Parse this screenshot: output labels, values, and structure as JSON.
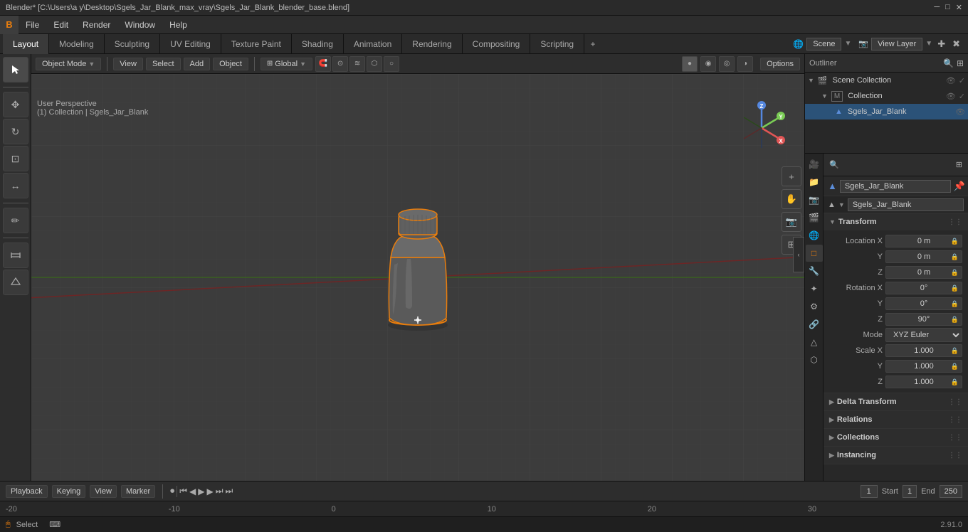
{
  "titlebar": {
    "title": "Blender* [C:\\Users\\a y\\Desktop\\Sgels_Jar_Blank_max_vray\\Sgels_Jar_Blank_blender_base.blend]",
    "minimize": "─",
    "maximize": "□",
    "close": "✕"
  },
  "menubar": {
    "logo": "B",
    "items": [
      "File",
      "Edit",
      "Render",
      "Window",
      "Help"
    ]
  },
  "workspace_tabs": {
    "tabs": [
      "Layout",
      "Modeling",
      "Sculpting",
      "UV Editing",
      "Texture Paint",
      "Shading",
      "Animation",
      "Rendering",
      "Compositing",
      "Scripting"
    ],
    "active": "Layout",
    "plus_label": "+",
    "scene_label": "Scene",
    "view_layer_label": "View Layer"
  },
  "viewport_header": {
    "mode_label": "Object Mode",
    "view_label": "View",
    "select_label": "Select",
    "add_label": "Add",
    "object_label": "Object",
    "transform_label": "Global",
    "snap_label": "Options",
    "options_label": "Options"
  },
  "viewport_info": {
    "perspective": "User Perspective",
    "collection": "(1) Collection | Sgels_Jar_Blank"
  },
  "toolbar": {
    "buttons": [
      "◻",
      "✥",
      "↻",
      "⊡",
      "↔",
      "✏",
      "▲"
    ]
  },
  "timeline": {
    "playback_label": "Playback",
    "keying_label": "Keying",
    "view_label": "View",
    "marker_label": "Marker",
    "frame_current": "1",
    "start_label": "Start",
    "start_val": "1",
    "end_label": "End",
    "end_val": "250"
  },
  "statusbar": {
    "select_label": "Select",
    "version": "2.91.0"
  },
  "outliner": {
    "scene_collection": "Scene Collection",
    "collection": "Collection",
    "object": "Sgels_Jar_Blank"
  },
  "properties": {
    "object_name": "Sgels_Jar_Blank",
    "data_name": "Sgels_Jar_Blank",
    "transform_section": "Transform",
    "location_label": "Location X",
    "location_x": "0 m",
    "location_y": "0 m",
    "location_z": "0 m",
    "rotation_label": "Rotation X",
    "rotation_x": "0°",
    "rotation_y": "0°",
    "rotation_z": "90°",
    "mode_label": "Mode",
    "mode_val": "XYZ Euler",
    "scale_label": "Scale X",
    "scale_x": "1.000",
    "scale_y": "1.000",
    "scale_z": "1.000",
    "delta_transform": "Delta Transform",
    "relations": "Relations",
    "collections": "Collections",
    "instancing": "Instancing"
  },
  "gizmo": {
    "x_label": "X",
    "y_label": "Y",
    "z_label": "Z",
    "x_color": "#e05555",
    "y_color": "#7acc55",
    "z_color": "#5588e0"
  }
}
